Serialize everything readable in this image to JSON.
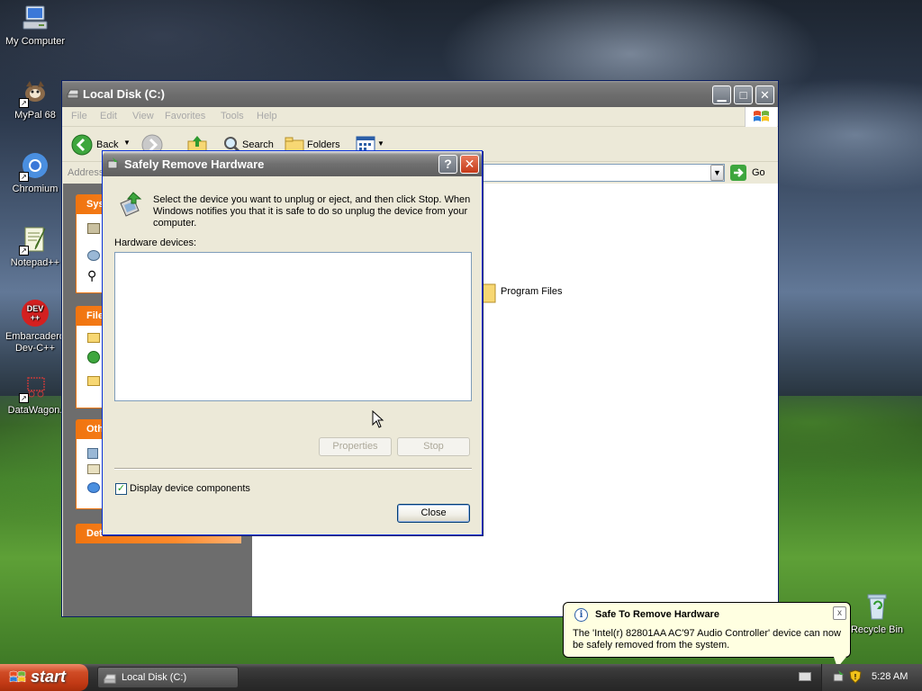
{
  "desktop": {
    "icons": [
      {
        "label": "My Computer",
        "icon": "my-computer-icon"
      },
      {
        "label": "MyPal 68",
        "icon": "mypal-icon"
      },
      {
        "label": "Chromium",
        "icon": "chromium-icon"
      },
      {
        "label": "Notepad++",
        "icon": "notepadpp-icon"
      },
      {
        "label": "Embarcadero Dev-C++",
        "icon": "devcpp-icon"
      },
      {
        "label": "DataWagon.",
        "icon": "datawagon-icon"
      },
      {
        "label": "Recycle Bin",
        "icon": "recycle-bin-icon"
      }
    ]
  },
  "explorer": {
    "title": "Local Disk (C:)",
    "menu": [
      "File",
      "Edit",
      "View",
      "Favorites",
      "Tools",
      "Help"
    ],
    "toolbar": {
      "back": "Back",
      "search": "Search",
      "folders": "Folders"
    },
    "address_label": "Address",
    "go_label": "Go",
    "task_panels": [
      {
        "title": "Sys"
      },
      {
        "title": "File"
      },
      {
        "title": "Oth"
      },
      {
        "title": "Det"
      }
    ],
    "items": [
      {
        "name": "Program Files"
      }
    ]
  },
  "dialog": {
    "title": "Safely Remove Hardware",
    "description": "Select the device you want to unplug or eject, and then click Stop. When Windows notifies you that it is safe to do so unplug the device from your computer.",
    "hardware_label": "Hardware devices:",
    "properties_label": "Properties",
    "stop_label": "Stop",
    "checkbox_label": "Display device components",
    "checkbox_checked": true,
    "close_label": "Close",
    "help_glyph": "?"
  },
  "balloon": {
    "title": "Safe To Remove Hardware",
    "message": "The 'Intel(r) 82801AA AC'97 Audio Controller' device can now be safely removed from the system.",
    "info_glyph": "i",
    "close_glyph": "x"
  },
  "taskbar": {
    "start_label": "start",
    "tasks": [
      {
        "label": "Local Disk (C:)"
      }
    ],
    "clock": "5:28 AM"
  },
  "colors": {
    "start_button": "#c23a15",
    "task_header": "#f0740f",
    "balloon_bg": "#ffffe1",
    "dialog_bg": "#ece9d8"
  }
}
